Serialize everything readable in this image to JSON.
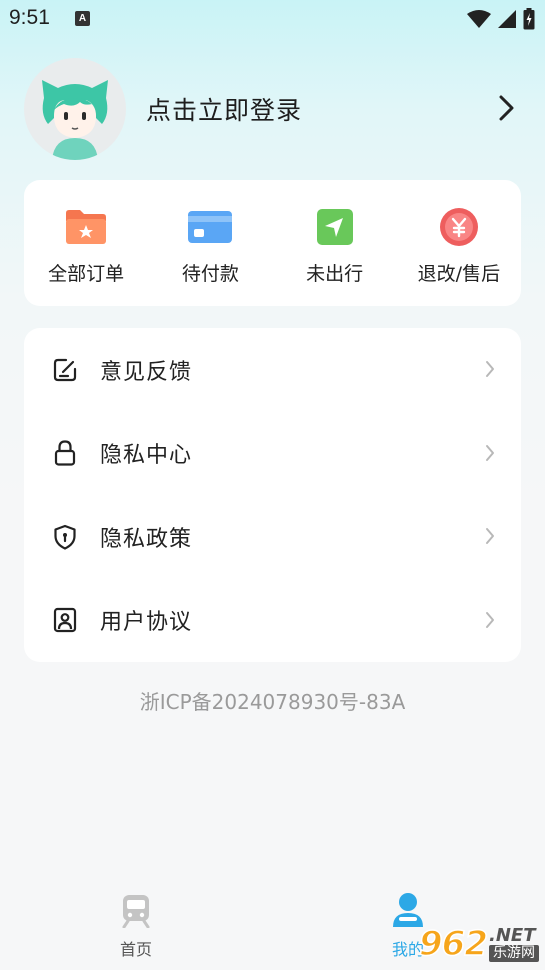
{
  "status_bar": {
    "time": "9:51",
    "notification_badge": "A"
  },
  "profile": {
    "login_text": "点击立即登录"
  },
  "orders": [
    {
      "label": "全部订单",
      "icon": "folder-star-icon",
      "color": "#f5764f"
    },
    {
      "label": "待付款",
      "icon": "card-icon",
      "color": "#5aa6f5"
    },
    {
      "label": "未出行",
      "icon": "navigation-icon",
      "color": "#69c85a"
    },
    {
      "label": "退改/售后",
      "icon": "yen-icon",
      "color": "#ee5e5e"
    }
  ],
  "menu": [
    {
      "label": "意见反馈",
      "icon": "feedback-edit-icon"
    },
    {
      "label": "隐私中心",
      "icon": "lock-icon"
    },
    {
      "label": "隐私政策",
      "icon": "shield-icon"
    },
    {
      "label": "用户协议",
      "icon": "user-document-icon"
    }
  ],
  "icp": "浙ICP备2024078930号-83A",
  "tabbar": {
    "tabs": [
      {
        "label": "首页",
        "icon": "train-icon",
        "active": false
      },
      {
        "label": "我的",
        "icon": "person-icon",
        "active": true
      }
    ],
    "active_color": "#2ca8e6"
  },
  "watermark": {
    "number": "962",
    "domain": ".NET",
    "name": "乐游网"
  }
}
